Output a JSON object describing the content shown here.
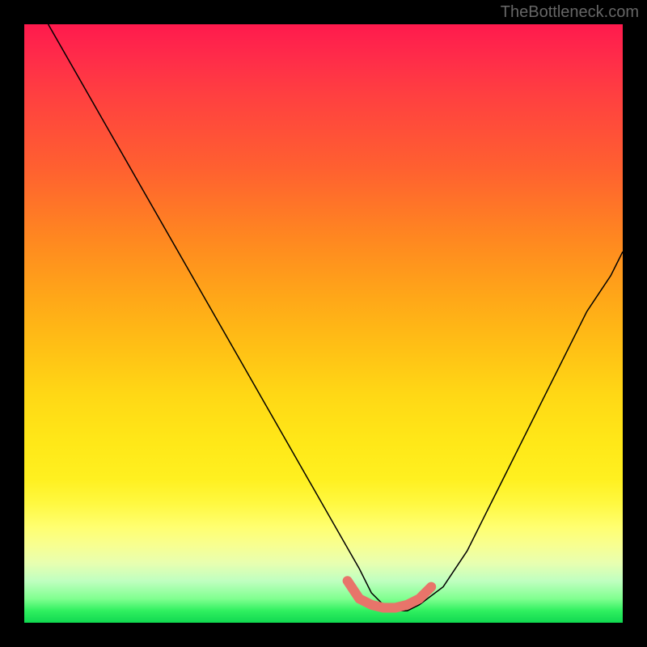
{
  "watermark": "TheBottleneck.com",
  "chart_data": {
    "type": "line",
    "title": "",
    "xlabel": "",
    "ylabel": "",
    "xlim": [
      0,
      100
    ],
    "ylim": [
      0,
      100
    ],
    "series": [
      {
        "name": "bottleneck-curve",
        "x": [
          4,
          8,
          12,
          16,
          20,
          24,
          28,
          32,
          36,
          40,
          44,
          48,
          52,
          56,
          58,
          60,
          62,
          64,
          66,
          70,
          74,
          78,
          82,
          86,
          90,
          94,
          98,
          100
        ],
        "y": [
          100,
          93,
          86,
          79,
          72,
          65,
          58,
          51,
          44,
          37,
          30,
          23,
          16,
          9,
          5,
          3,
          2,
          2,
          3,
          6,
          12,
          20,
          28,
          36,
          44,
          52,
          58,
          62
        ]
      }
    ],
    "highlight": {
      "name": "optimal-zone",
      "x": [
        54,
        56,
        58,
        60,
        62,
        64,
        66,
        68
      ],
      "y": [
        7,
        4,
        3,
        2.5,
        2.5,
        3,
        4,
        6
      ],
      "color": "#e8746a"
    },
    "background": "rainbow-gradient-red-to-green-vertical"
  }
}
